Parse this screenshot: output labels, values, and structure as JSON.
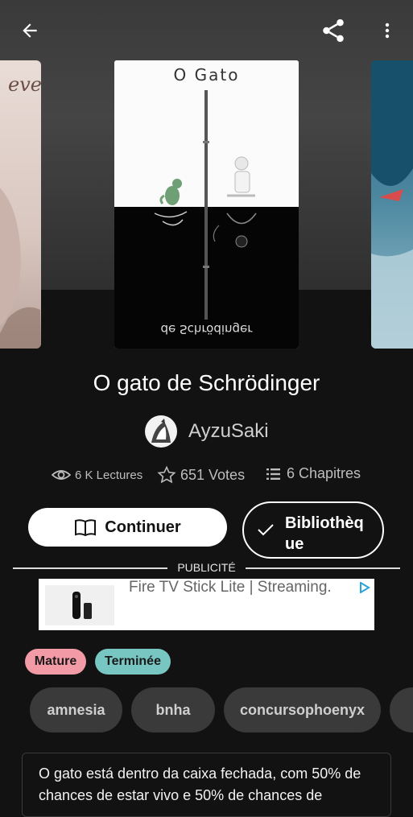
{
  "header": {
    "back_icon": "arrow-left-icon",
    "share_icon": "share-icon",
    "more_icon": "more-vertical-icon"
  },
  "cover": {
    "title_text": "O Gato",
    "mirror_text": "de Schrödinger"
  },
  "book": {
    "title": "O gato de Schrödinger",
    "author": "AyzuSaki"
  },
  "stats": {
    "reads": "6 K Lectures",
    "votes": "651 Votes",
    "chapters": "6 Chapitres"
  },
  "actions": {
    "continue_label": "Continuer",
    "library_label_1": "Bibliothèq",
    "library_label_2": "ue"
  },
  "ad": {
    "label": "PUBLICITÉ",
    "text": "Fire TV Stick Lite | Streaming."
  },
  "badges": [
    "Mature",
    "Terminée"
  ],
  "tags": [
    "amnesia",
    "bnha",
    "concursophoenyx"
  ],
  "description": {
    "text": "O gato está dentro da caixa fechada, com 50% de chances de estar vivo e 50% de chances de"
  },
  "colors": {
    "background": "#121212",
    "mature_badge": "#f29aa6",
    "completed_badge": "#78c6c2",
    "tag_background": "#3a3a3a"
  }
}
